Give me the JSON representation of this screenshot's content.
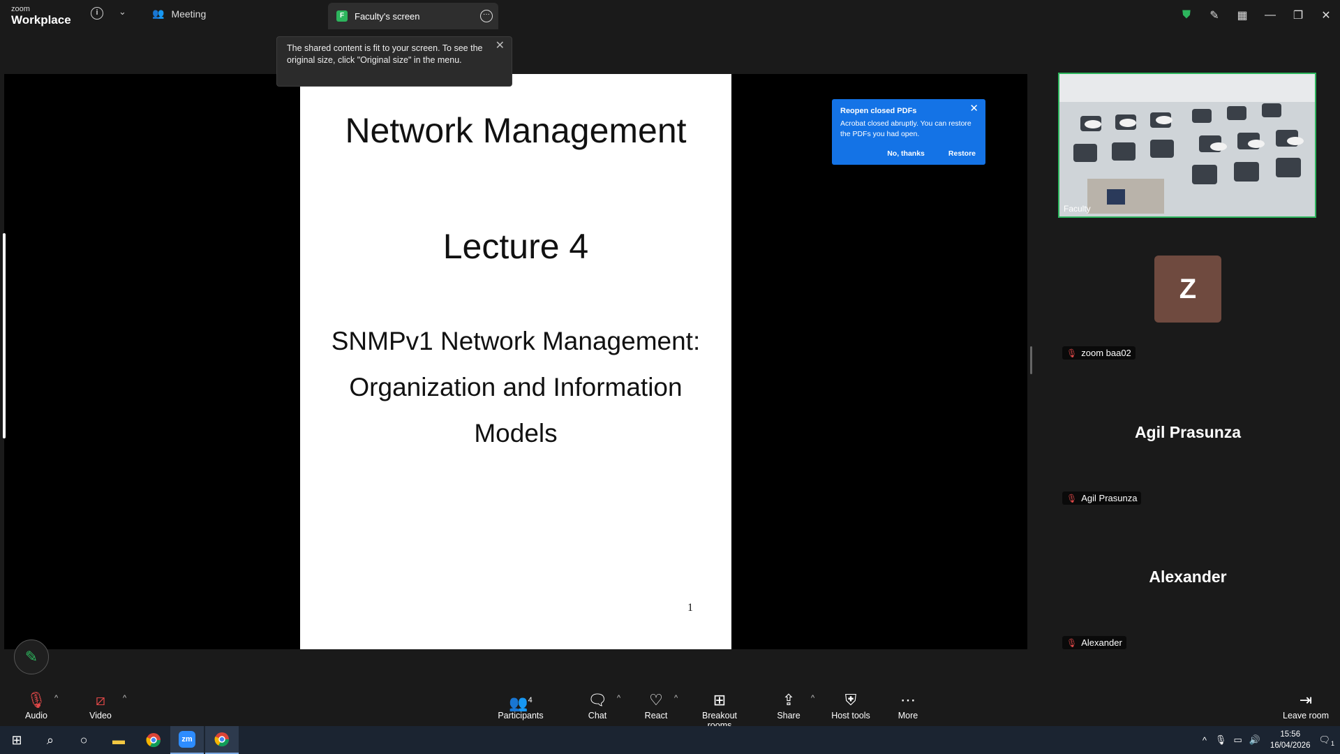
{
  "app": {
    "logo_small": "zoom",
    "logo_big": "Workplace"
  },
  "header": {
    "meeting_tab": "Meeting",
    "screen_tab": {
      "badge": "F",
      "label": "Faculty's screen"
    }
  },
  "toast": {
    "text": "The shared content is fit to your screen. To see the original size, click \"Original size\" in the menu."
  },
  "slide": {
    "title": "Network Management",
    "subtitle": "Lecture 4",
    "topic_line1": "SNMPv1 Network Management:",
    "topic_line2": "Organization and Information",
    "topic_line3": "Models",
    "page_number": "1"
  },
  "acrobat_popup": {
    "title": "Reopen closed PDFs",
    "body": "Acrobat closed abruptly. You can restore the PDFs you had open.",
    "no_label": "No, thanks",
    "restore_label": "Restore"
  },
  "gallery": {
    "video_tile_name": "Faculty",
    "avatar_letter": "Z",
    "p1_label": "zoom baa02",
    "p2_big": "Agil Prasunza",
    "p2_label": "Agil Prasunza",
    "p3_big": "Alexander",
    "p3_label": "Alexander"
  },
  "toolbar": {
    "audio": "Audio",
    "video": "Video",
    "participants": "Participants",
    "participants_count": "4",
    "chat": "Chat",
    "react": "React",
    "breakout": "Breakout rooms",
    "share": "Share",
    "host_tools": "Host tools",
    "more": "More",
    "leave": "Leave room"
  },
  "taskbar": {
    "time": "15:56",
    "date": "16/04/2026",
    "notif_count": "1"
  },
  "colors": {
    "accent_green": "#2db55d",
    "acrobat_blue": "#1473e6",
    "muted_red": "#e04848"
  }
}
